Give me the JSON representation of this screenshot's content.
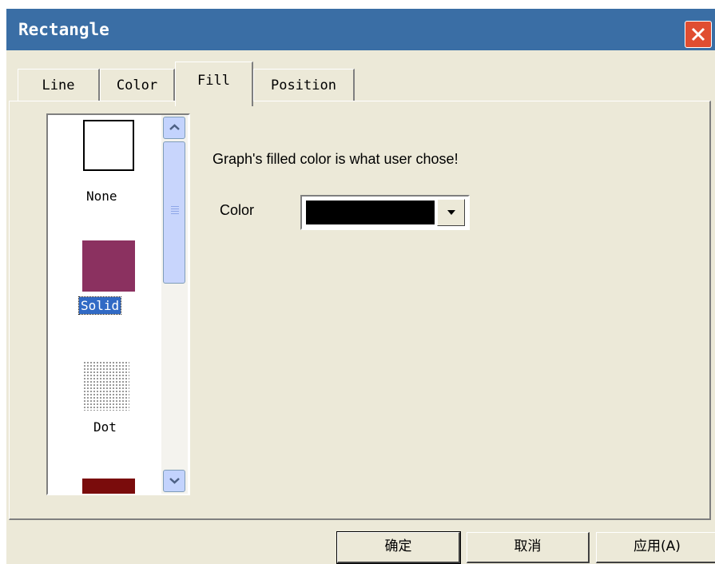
{
  "window": {
    "title": "Rectangle"
  },
  "tabs": [
    {
      "label": "Line"
    },
    {
      "label": "Color"
    },
    {
      "label": "Fill"
    },
    {
      "label": "Position"
    }
  ],
  "active_tab": "Fill",
  "fill_styles": [
    {
      "label": "None"
    },
    {
      "label": "Solid",
      "selected": true
    },
    {
      "label": "Dot"
    }
  ],
  "fill_panel": {
    "message": "Graph's filled color is what user chose!",
    "color_label": "Color",
    "color_value": "#000000"
  },
  "buttons": {
    "ok": "确定",
    "cancel": "取消",
    "apply": "应用(A)"
  },
  "colors": {
    "titlebar": "#3a6ea5",
    "solid_swatch": "#8b3160",
    "selection": "#316ac5",
    "close": "#e04d31"
  },
  "icons": [
    "close-icon",
    "scroll-up-icon",
    "scroll-down-icon",
    "chevron-down-icon"
  ]
}
